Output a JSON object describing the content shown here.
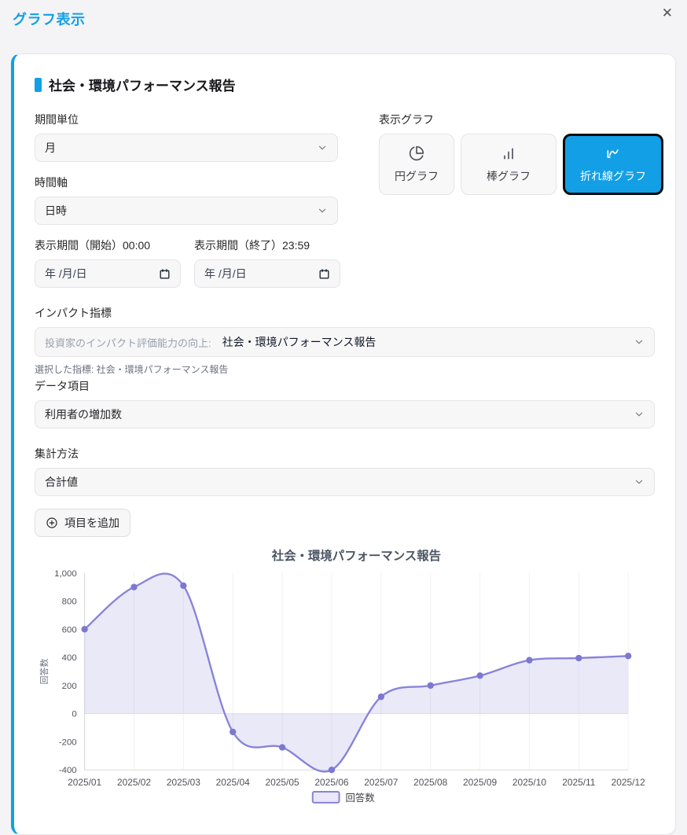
{
  "window": {
    "title": "グラフ表示",
    "close": "✕"
  },
  "panel": {
    "heading": "社会・環境パフォーマンス報告"
  },
  "form": {
    "period_unit": {
      "label": "期間単位",
      "value": "月"
    },
    "display_graph": {
      "label": "表示グラフ",
      "options": [
        {
          "label": "円グラフ",
          "icon": "pie-chart-icon",
          "selected": false
        },
        {
          "label": "棒グラフ",
          "icon": "bar-chart-icon",
          "selected": false
        },
        {
          "label": "折れ線グラフ",
          "icon": "line-chart-icon",
          "selected": true
        }
      ]
    },
    "time_axis": {
      "label": "時間軸",
      "value": "日時"
    },
    "period_start": {
      "label": "表示期間（開始）00:00",
      "placeholder": "年 /月/日"
    },
    "period_end": {
      "label": "表示期間（終了）23:59",
      "placeholder": "年 /月/日"
    },
    "impact_indicator": {
      "label": "インパクト指標",
      "value_prefix": "投資家のインパクト評価能力の向上:",
      "value": "社会・環境パフォーマンス報告",
      "note": "選択した指標: 社会・環境パフォーマンス報告"
    },
    "data_item": {
      "label": "データ項目",
      "value": "利用者の増加数"
    },
    "aggregation": {
      "label": "集計方法",
      "value": "合計値"
    },
    "add_item": {
      "label": "項目を追加"
    }
  },
  "chart_data": {
    "type": "line",
    "title": "社会・環境パフォーマンス報告",
    "xlabel": "",
    "ylabel": "回答数",
    "categories": [
      "2025/01",
      "2025/02",
      "2025/03",
      "2025/04",
      "2025/05",
      "2025/06",
      "2025/07",
      "2025/08",
      "2025/09",
      "2025/10",
      "2025/11",
      "2025/12"
    ],
    "series": [
      {
        "name": "回答数",
        "values": [
          600,
          900,
          910,
          -130,
          -240,
          -400,
          120,
          200,
          270,
          380,
          395,
          410
        ]
      }
    ],
    "ylim": [
      -400,
      1000
    ],
    "yticks": [
      1000,
      800,
      600,
      400,
      200,
      0,
      -200,
      -400
    ],
    "grid": true,
    "legend_position": "bottom",
    "line_color": "#8884d8",
    "point_color": "#7c78d2",
    "fill_color": "#8884d8",
    "fill_opacity": 0.18
  },
  "colors": {
    "accent": "#129fe6"
  }
}
